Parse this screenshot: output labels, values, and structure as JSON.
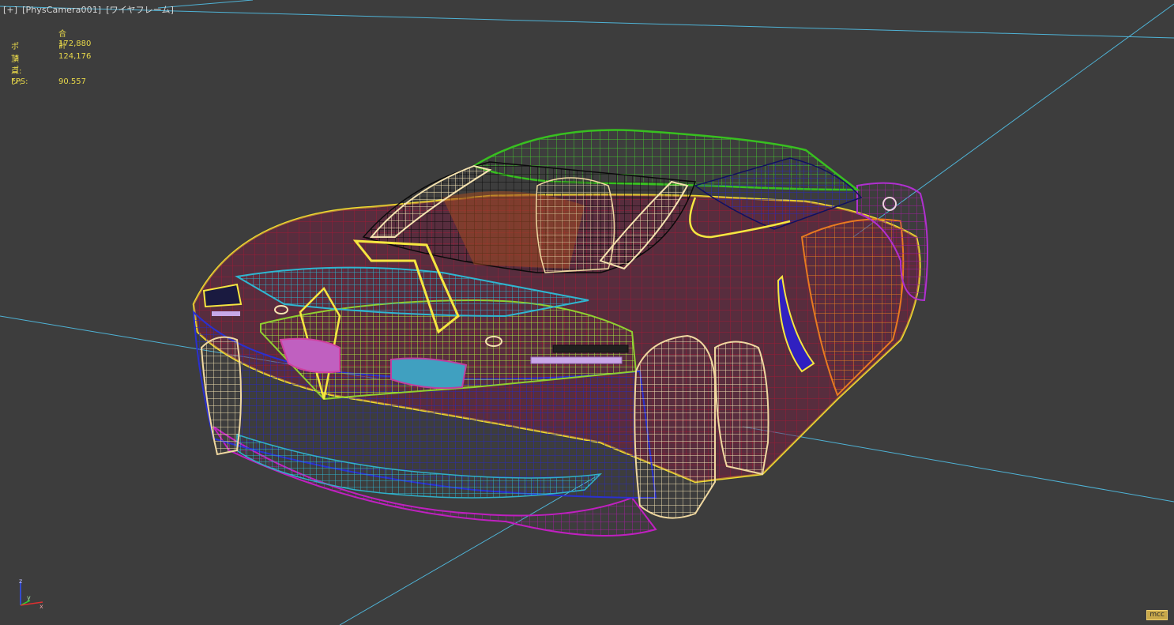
{
  "viewport": {
    "label_plus": "[+]",
    "label_camera": "[PhysCamera001]",
    "label_mode": "[ワイヤフレーム]"
  },
  "stats": {
    "header": "合計",
    "polygons_label": "ポリゴン:",
    "polygons_value": "172,880",
    "vertices_label": "頂点:",
    "vertices_value": "124,176",
    "fps_label": "FPS:",
    "fps_value": "90.557"
  },
  "axis": {
    "z": "z",
    "y": "y",
    "x": "x"
  },
  "badge": "mcc",
  "colors": {
    "background": "#3d3d3d",
    "grid_line": "#4fb3d6",
    "stats_text": "#e8d84a"
  }
}
